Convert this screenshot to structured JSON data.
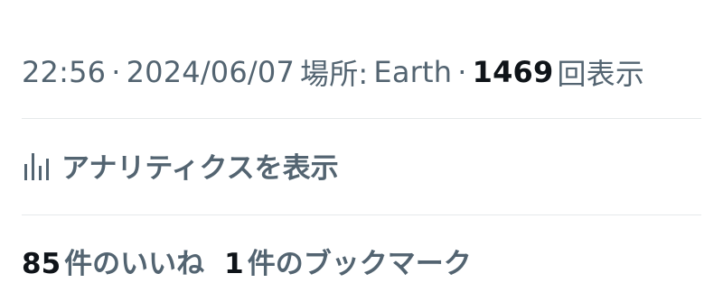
{
  "meta": {
    "time": "22:56",
    "separator": "·",
    "date": "2024/06/07",
    "location_prefix": "場所:",
    "location": "Earth",
    "views_count": "1469",
    "views_label": "回表示"
  },
  "analytics": {
    "icon": "bar-chart-icon",
    "label": "アナリティクスを表示"
  },
  "stats": {
    "likes_count": "85",
    "likes_label": "件のいいね",
    "bookmarks_count": "1",
    "bookmarks_label": "件のブックマーク"
  },
  "colors": {
    "secondary_text": "#536471",
    "primary_text": "#0f1419",
    "divider": "#e6e9eb"
  }
}
